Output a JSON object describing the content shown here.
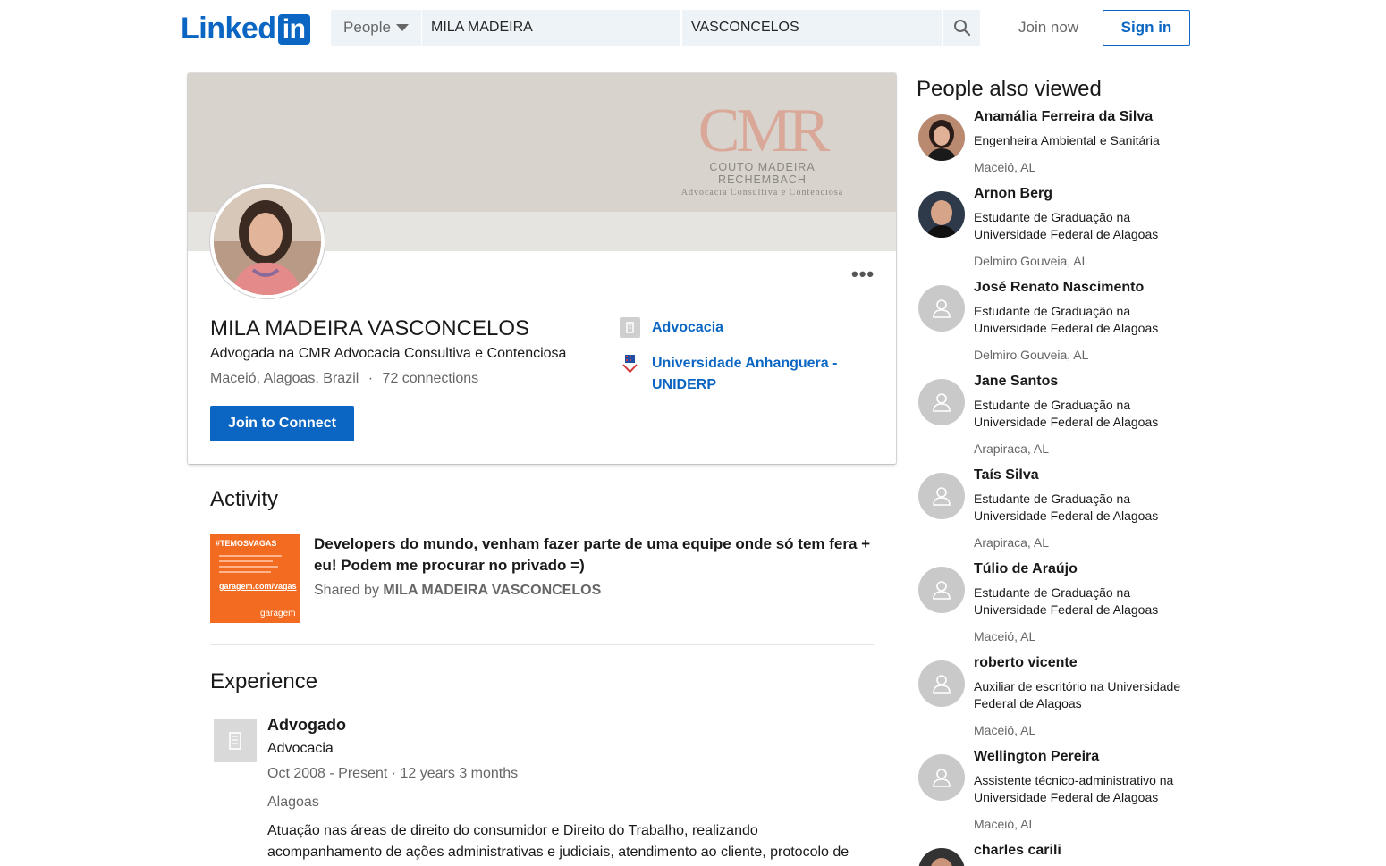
{
  "header": {
    "logo_text": "Linked",
    "logo_box": "in",
    "search_type": "People",
    "first_name": "MILA MADEIRA",
    "last_name": "VASCONCELOS",
    "join_now": "Join now",
    "sign_in": "Sign in"
  },
  "banner": {
    "mark": "CMR",
    "company": "COUTO MADEIRA RECHEMBACH",
    "tagline": "Advocacia Consultiva e Contenciosa"
  },
  "profile": {
    "name": "MILA MADEIRA VASCONCELOS",
    "headline": "Advogada na CMR Advocacia Consultiva e Contenciosa",
    "location": "Maceió, Alagoas, Brazil",
    "separator": "·",
    "connections": "72 connections",
    "join_button": "Join to Connect",
    "company_link": "Advocacia",
    "school_link": "Universidade Anhanguera - UNIDERP"
  },
  "activity": {
    "title": "Activity",
    "thumb_tag": "#TEMOSVAGAS",
    "thumb_url": "garagem.com/vagas",
    "thumb_brand": "garagem",
    "post_title": "Developers do mundo, venham fazer parte de uma equipe onde só tem fera + eu! Podem me procurar no privado =)",
    "shared_by_label": "Shared by",
    "shared_by_name": "MILA MADEIRA VASCONCELOS"
  },
  "experience": {
    "title": "Experience",
    "role": "Advogado",
    "company": "Advocacia",
    "dates": "Oct 2008 - Present · 12 years 3 months",
    "location": "Alagoas",
    "description": "Atuação nas áreas de direito do consumidor e Direito do Trabalho, realizando acompanhamento de ações administrativas e judiciais, atendimento ao cliente, protocolo de documentos etc."
  },
  "people_also_viewed": {
    "title": "People also viewed",
    "people": [
      {
        "name": "Anamália Ferreira da Silva",
        "headline": "Engenheira Ambiental e Sanitária",
        "location": "Maceió, AL"
      },
      {
        "name": "Arnon Berg",
        "headline": "Estudante de Graduação na Universidade Federal de Alagoas",
        "location": "Delmiro Gouveia, AL"
      },
      {
        "name": "José Renato Nascimento",
        "headline": "Estudante de Graduação na Universidade Federal de Alagoas",
        "location": "Delmiro Gouveia, AL"
      },
      {
        "name": "Jane Santos",
        "headline": "Estudante de Graduação na Universidade Federal de Alagoas",
        "location": "Arapiraca, AL"
      },
      {
        "name": "Taís Silva",
        "headline": "Estudante de Graduação na Universidade Federal de Alagoas",
        "location": "Arapiraca, AL"
      },
      {
        "name": "Túlio de Araújo",
        "headline": "Estudante de Graduação na Universidade Federal de Alagoas",
        "location": "Maceió, AL"
      },
      {
        "name": "roberto vicente",
        "headline": "Auxiliar de escritório na Universidade Federal de Alagoas",
        "location": "Maceió, AL"
      },
      {
        "name": "Wellington Pereira",
        "headline": "Assistente técnico-administrativo na Universidade Federal de Alagoas",
        "location": "Maceió, AL"
      },
      {
        "name": "charles carili",
        "headline": "",
        "location": ""
      }
    ]
  },
  "colors": {
    "brand": "#0a66c2",
    "banner": "#d8d3cc",
    "banner_mark": "#d9a898",
    "activity_thumb": "#f26b21"
  }
}
